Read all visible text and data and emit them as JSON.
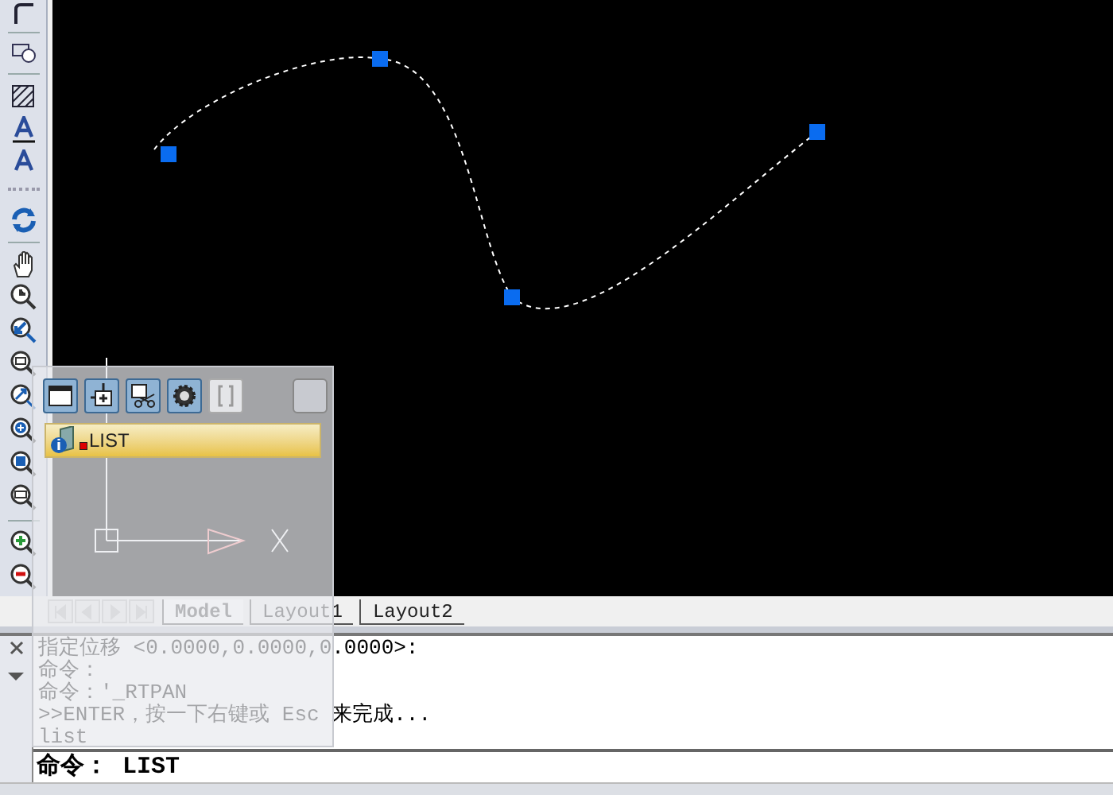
{
  "panel_list": {
    "items": [
      {
        "label": "LIST",
        "selected": true
      }
    ]
  },
  "layout_tabs": [
    {
      "label": "Model",
      "selected": true
    },
    {
      "label": "Layout1",
      "selected": false
    },
    {
      "label": "Layout2",
      "selected": false
    }
  ],
  "command_history": [
    "指定位移 <0.0000,0.0000,0.0000>:",
    "命令：",
    "命令：'_RTPAN",
    ">>ENTER，按一下右键或 Esc 来完成...",
    "list"
  ],
  "command_line": {
    "value": "命令： LIST"
  }
}
